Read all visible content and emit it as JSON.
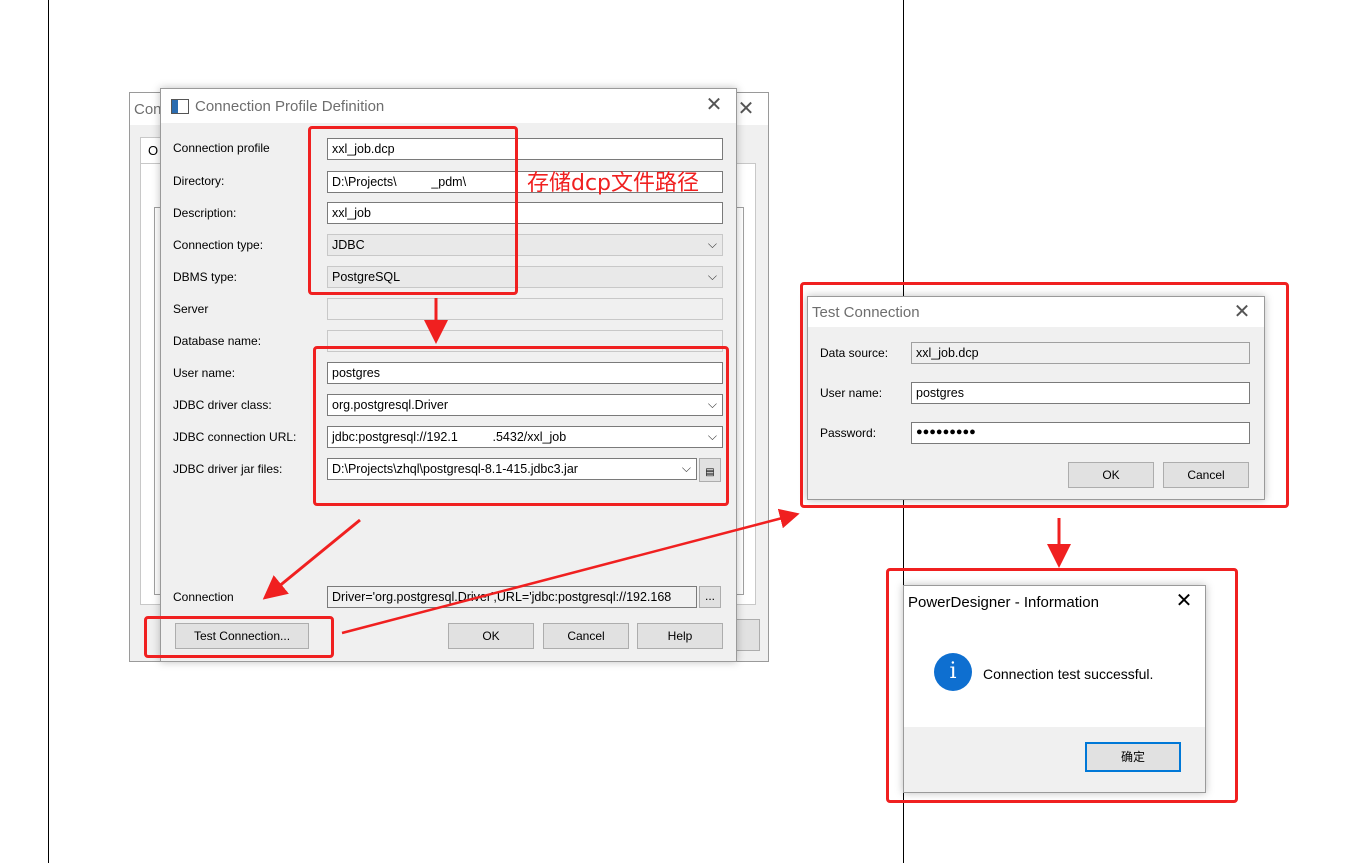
{
  "background_dialog": {
    "title_fragment": "Con",
    "tab_fragment": "O"
  },
  "profile_dialog": {
    "title": "Connection Profile Definition",
    "fields": {
      "connection_profile": {
        "label": "Connection profile",
        "value": "xxl_job.dcp"
      },
      "directory": {
        "label": "Directory:",
        "value": "D:\\Projects\\          _pdm\\"
      },
      "description": {
        "label": "Description:",
        "value": "xxl_job"
      },
      "connection_type": {
        "label": "Connection type:",
        "value": "JDBC"
      },
      "dbms_type": {
        "label": "DBMS type:",
        "value": "PostgreSQL"
      },
      "server": {
        "label": "Server",
        "value": ""
      },
      "database_name": {
        "label": "Database name:",
        "value": ""
      },
      "user_name": {
        "label": "User name:",
        "value": "postgres"
      },
      "jdbc_driver_class": {
        "label": "JDBC driver class:",
        "value": "org.postgresql.Driver"
      },
      "jdbc_connection_url": {
        "label": "JDBC connection URL:",
        "value": "jdbc:postgresql://192.1          .5432/xxl_job"
      },
      "jdbc_driver_jar_files": {
        "label": "JDBC driver jar files:",
        "value": "D:\\Projects\\zhql\\postgresql-8.1-415.jdbc3.jar"
      },
      "connection": {
        "label": "Connection",
        "value": "Driver='org.postgresql.Driver',URL='jdbc:postgresql://192.168"
      }
    },
    "ellipsis_label": "...",
    "buttons": {
      "test_connection": "Test Connection...",
      "ok": "OK",
      "cancel": "Cancel",
      "help": "Help"
    }
  },
  "annotation": {
    "text": "存储dcp文件路径",
    "color": "#f02020"
  },
  "test_dialog": {
    "title": "Test Connection",
    "data_source": {
      "label": "Data source:",
      "value": "xxl_job.dcp"
    },
    "user_name": {
      "label": "User name:",
      "value": "postgres"
    },
    "password": {
      "label": "Password:",
      "value": "●●●●●●●●●"
    },
    "buttons": {
      "ok": "OK",
      "cancel": "Cancel"
    }
  },
  "info_dialog": {
    "title": "PowerDesigner - Information",
    "message": "Connection test successful.",
    "icon_glyph": "i",
    "button": "确定"
  },
  "colors": {
    "accent": "#0078d7",
    "highlight": "#f02020",
    "window_bg": "#f0f0f0"
  }
}
